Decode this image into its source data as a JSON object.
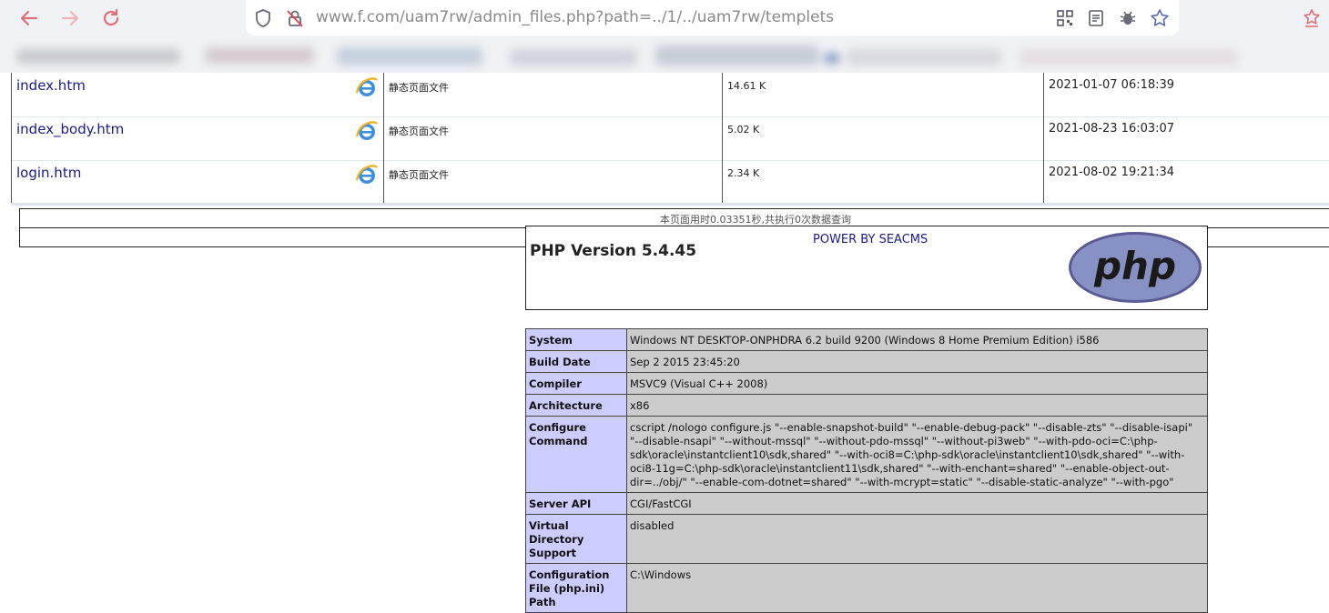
{
  "browser": {
    "url": "www.f.com/uam7rw/admin_files.php?path=../1/../uam7rw/templets",
    "icons": [
      "back-icon",
      "forward-icon",
      "reload-icon",
      "shield-icon",
      "insecure-lock-icon",
      "qr-code-icon",
      "reader-mode-icon",
      "bug-icon",
      "star-icon",
      "extension-icon"
    ]
  },
  "files": [
    {
      "name": "index.htm",
      "type": "静态页面文件",
      "size": "14.61 K",
      "modified": "2021-01-07 06:18:39"
    },
    {
      "name": "index_body.htm",
      "type": "静态页面文件",
      "size": "5.02 K",
      "modified": "2021-08-23 16:03:07"
    },
    {
      "name": "login.htm",
      "type": "静态页面文件",
      "size": "2.34 K",
      "modified": "2021-08-02 19:21:34"
    }
  ],
  "footer": {
    "timing": "本页面用时0.03351秒,共执行0次数据查询",
    "power": "POWER BY SEACMS"
  },
  "phpinfo": {
    "title": "PHP Version 5.4.45",
    "logo_text": "php",
    "rows": [
      {
        "key": "System",
        "value": "Windows NT DESKTOP-ONPHDRA 6.2 build 9200 (Windows 8 Home Premium Edition) i586"
      },
      {
        "key": "Build Date",
        "value": "Sep 2 2015 23:45:20"
      },
      {
        "key": "Compiler",
        "value": "MSVC9 (Visual C++ 2008)"
      },
      {
        "key": "Architecture",
        "value": "x86"
      },
      {
        "key": "Configure Command",
        "value": "cscript /nologo configure.js \"--enable-snapshot-build\" \"--enable-debug-pack\" \"--disable-zts\" \"--disable-isapi\" \"--disable-nsapi\" \"--without-mssql\" \"--without-pdo-mssql\" \"--without-pi3web\" \"--with-pdo-oci=C:\\php-sdk\\oracle\\instantclient10\\sdk,shared\" \"--with-oci8=C:\\php-sdk\\oracle\\instantclient10\\sdk,shared\" \"--with-oci8-11g=C:\\php-sdk\\oracle\\instantclient11\\sdk,shared\" \"--with-enchant=shared\" \"--enable-object-out-dir=../obj/\" \"--enable-com-dotnet=shared\" \"--with-mcrypt=static\" \"--disable-static-analyze\" \"--with-pgo\""
      },
      {
        "key": "Server API",
        "value": "CGI/FastCGI"
      },
      {
        "key": "Virtual Directory Support",
        "value": "disabled"
      },
      {
        "key": "Configuration File (php.ini) Path",
        "value": "C:\\Windows"
      }
    ]
  }
}
